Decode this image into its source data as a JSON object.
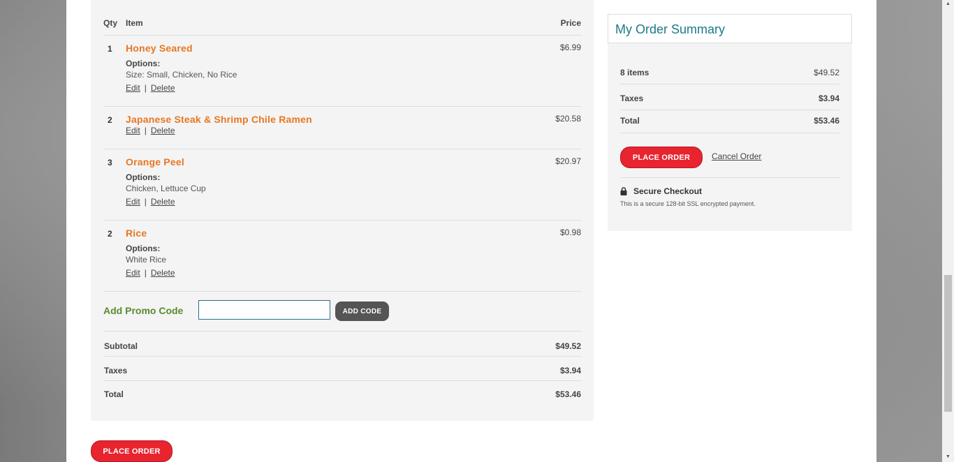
{
  "cart": {
    "headers": {
      "qty": "Qty",
      "item": "Item",
      "price": "Price"
    },
    "options_label": "Options:",
    "edit_label": "Edit",
    "delete_label": "Delete",
    "separator": "|",
    "items": [
      {
        "qty": "1",
        "name": "Honey Seared",
        "price": "$6.99",
        "options": "Size: Small, Chicken, No Rice"
      },
      {
        "qty": "2",
        "name": "Japanese Steak & Shrimp Chile Ramen",
        "price": "$20.58",
        "options": ""
      },
      {
        "qty": "3",
        "name": "Orange Peel",
        "price": "$20.97",
        "options": "Chicken, Lettuce Cup"
      },
      {
        "qty": "2",
        "name": "Rice",
        "price": "$0.98",
        "options": "White Rice"
      }
    ],
    "promo": {
      "label": "Add Promo Code",
      "input_value": "",
      "button_label": "ADD CODE"
    },
    "totals": {
      "subtotal_label": "Subtotal",
      "subtotal": "$49.52",
      "taxes_label": "Taxes",
      "taxes": "$3.94",
      "total_label": "Total",
      "total": "$53.46"
    },
    "place_order_label": "PLACE ORDER"
  },
  "summary": {
    "title": "My Order Summary",
    "items_label": "8 items",
    "items_value": "$49.52",
    "taxes_label": "Taxes",
    "taxes_value": "$3.94",
    "total_label": "Total",
    "total_value": "$53.46",
    "place_order_label": "PLACE ORDER",
    "cancel_label": "Cancel Order",
    "secure_title": "Secure Checkout",
    "secure_desc": "This is a secure 128-bit SSL encrypted payment.",
    "lock_icon": "lock-icon"
  },
  "colors": {
    "accent_orange": "#e87722",
    "promo_green": "#5a8a2e",
    "title_teal": "#1c7a88",
    "button_red": "#e8242f"
  }
}
